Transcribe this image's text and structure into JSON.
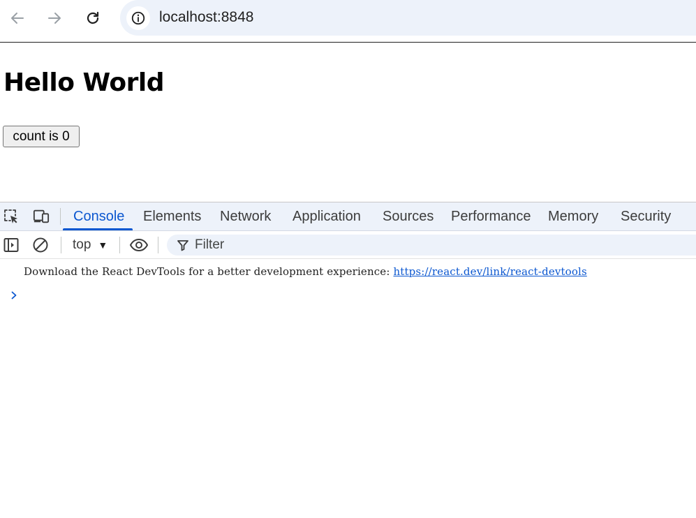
{
  "browser": {
    "url": "localhost:8848"
  },
  "page": {
    "heading": "Hello World",
    "count_button_label": "count is 0"
  },
  "devtools": {
    "tabs": [
      {
        "label": "Console",
        "active": true
      },
      {
        "label": "Elements",
        "active": false
      },
      {
        "label": "Network",
        "active": false
      },
      {
        "label": "Application",
        "active": false
      },
      {
        "label": "Sources",
        "active": false
      },
      {
        "label": "Performance",
        "active": false
      },
      {
        "label": "Memory",
        "active": false
      },
      {
        "label": "Security",
        "active": false
      }
    ],
    "console_toolbar": {
      "context": "top",
      "filter_placeholder": "Filter"
    },
    "console": {
      "message_text": "Download the React DevTools for a better development experience: ",
      "message_link": "https://react.dev/link/react-devtools"
    },
    "colors": {
      "accent": "#0b57d0",
      "tabbar_bg": "#edf2fa"
    },
    "icons": [
      "inspect-element-icon",
      "device-toolbar-icon",
      "sidebar-toggle-icon",
      "clear-console-icon",
      "live-expression-eye-icon",
      "filter-icon",
      "prompt-chevron-icon"
    ]
  }
}
